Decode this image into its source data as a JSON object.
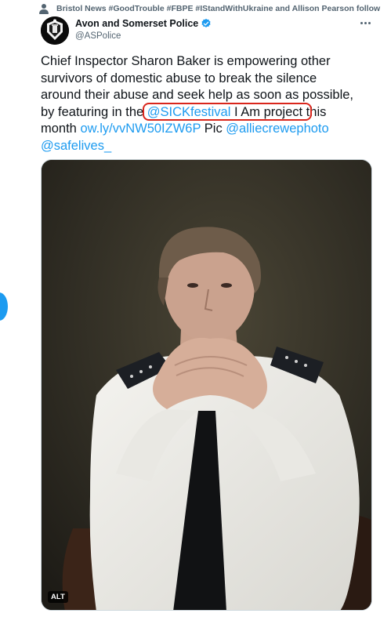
{
  "social_context": {
    "text": "Bristol News #GoodTrouble #FBPE #IStandWithUkraine and Allison Pearson follow",
    "icon": "person-icon"
  },
  "author": {
    "name": "Avon and Somerset Police",
    "handle": "@ASPolice",
    "verified_icon": "verified-badge-icon"
  },
  "tweet": {
    "line1": "Chief Inspector Sharon Baker is empowering other",
    "line2": "survivors of domestic abuse to break the silence",
    "line3": "around their abuse and seek help as soon as possible,",
    "line4_pre": "by featuring in the ",
    "mention_sickfestival": "@SICKfestival",
    "line4_mid": " I Am project",
    "line4_post": " this",
    "line5_pre": "month ",
    "short_link": "ow.ly/vvNW50IZW6P",
    "line5_mid": " Pic ",
    "mention_photographer": "@alliecrewephoto",
    "mention_safelives": "@safelives_"
  },
  "media": {
    "alt_badge": "ALT"
  },
  "colors": {
    "link": "#1d9bf0",
    "annotation_circle": "#d9261c",
    "secondary_text": "#536471"
  }
}
